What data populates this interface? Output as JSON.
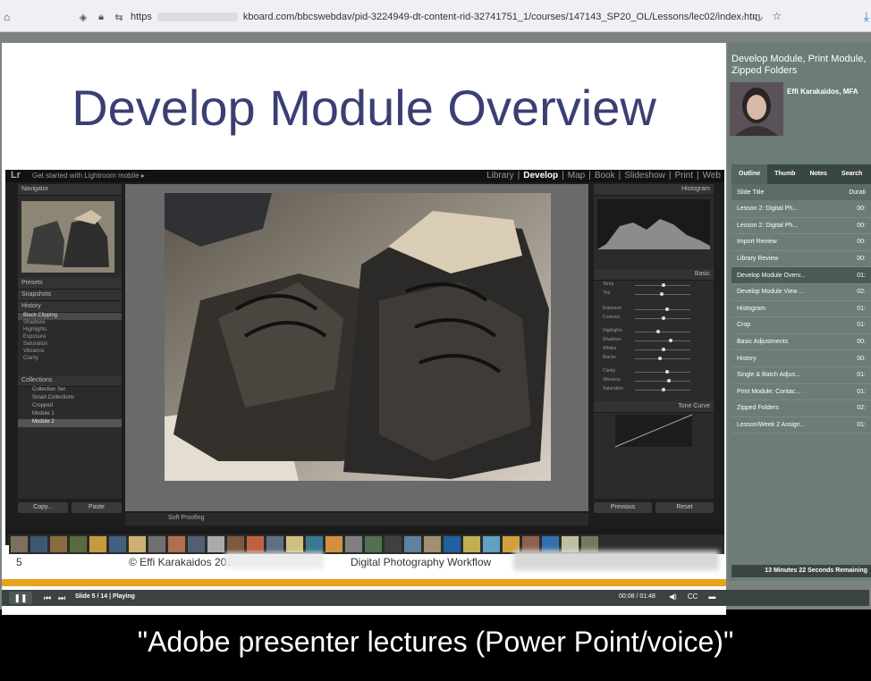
{
  "browser": {
    "url_prefix": "https",
    "url_suffix": "kboard.com/bbcswebdav/pid-3224949-dt-content-rid-32741751_1/courses/147143_SP20_OL/Lessons/lec02/index.htm",
    "more_label": "···"
  },
  "slide": {
    "title": "Develop Module Overview",
    "number": "5",
    "copyright": "© Effi Karakaidos 201",
    "course": "Digital Photography Workflow"
  },
  "lightroom": {
    "get_started": "Get started with Lightroom mobile ▸",
    "modules": [
      "Library",
      "Develop",
      "Map",
      "Book",
      "Slideshow",
      "Print",
      "Web"
    ],
    "active_module": "Develop",
    "left_panels": {
      "navigator": "Navigator",
      "presets": "Presets",
      "snapshots": "Snapshots",
      "history": "History",
      "collections": "Collections"
    },
    "history_items": [
      "Black Clipping",
      "Shadows",
      "Highlights",
      "Exposure",
      "Saturation",
      "Vibrance",
      "Clarity"
    ],
    "collection_items": [
      "Collection Set",
      "Smart Collections",
      "Cropped",
      "Module 1",
      "Module 2"
    ],
    "copy_label": "Copy...",
    "paste_label": "Paste",
    "soft_proofing": "Soft Proofing",
    "right_panels": {
      "histogram": "Histogram",
      "basic": "Basic",
      "tone_curve": "Tone Curve"
    },
    "basic_sliders": [
      "Temp",
      "Tint",
      "Exposure",
      "Contrast",
      "Highlights",
      "Shadows",
      "Whites",
      "Blacks",
      "Clarity",
      "Vibrance",
      "Saturation"
    ],
    "previous_label": "Previous",
    "reset_label": "Reset"
  },
  "sidebar": {
    "title": "Develop Module, Print Module, Zipped Folders",
    "presenter": "Effi Karakaidos, MFA",
    "tabs": [
      "Outline",
      "Thumb",
      "Notes",
      "Search"
    ],
    "active_tab": "Outline",
    "header_title": "Slide Title",
    "header_duration": "Durati",
    "rows": [
      {
        "title": "Lesson 2: Digital Ph...",
        "dur": "00:"
      },
      {
        "title": "Lesson 2: Digital Ph...",
        "dur": "00:"
      },
      {
        "title": "Import Review",
        "dur": "00:"
      },
      {
        "title": "Library Review",
        "dur": "00:"
      },
      {
        "title": "Develop Module Overv...",
        "dur": "01:"
      },
      {
        "title": "Develop Module View ...",
        "dur": "02:"
      },
      {
        "title": "Histogram",
        "dur": "01:"
      },
      {
        "title": "Crop",
        "dur": "01:"
      },
      {
        "title": "Basic Adjustments",
        "dur": "00:"
      },
      {
        "title": "History",
        "dur": "00:"
      },
      {
        "title": "Single & Batch Adjus...",
        "dur": "01:"
      },
      {
        "title": "Print Module: Contac...",
        "dur": "01:"
      },
      {
        "title": "Zipped Folders",
        "dur": "02:"
      },
      {
        "title": "Lesson/Week 2 Assign...",
        "dur": "01:"
      }
    ],
    "current_index": 4,
    "remaining": "13 Minutes 22 Seconds Remaining"
  },
  "controls": {
    "slide_status": "Slide 5 / 14 | Playing",
    "time": "00:08 / 01:48",
    "cc": "CC"
  },
  "caption": "\"Adobe presenter lectures (Power Point/voice)\""
}
